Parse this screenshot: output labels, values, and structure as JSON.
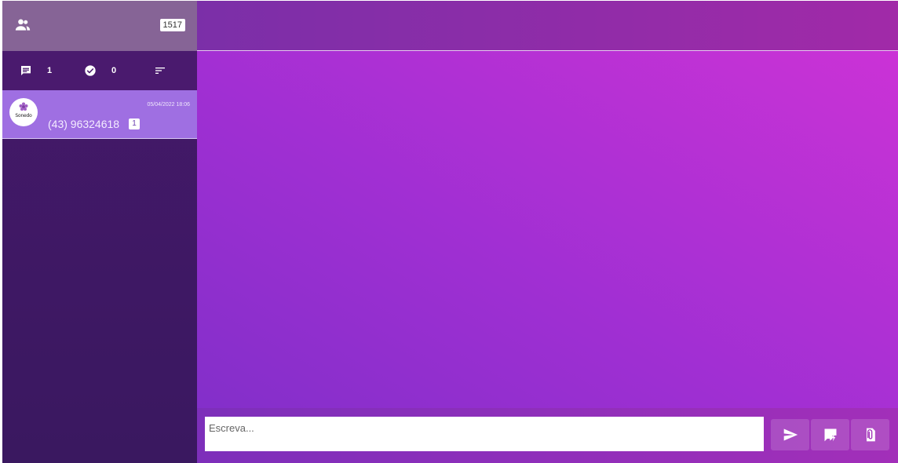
{
  "sidebar": {
    "contacts_count": "1517",
    "filters": [
      {
        "icon": "chat-icon",
        "count": "1"
      },
      {
        "icon": "check-circle-icon",
        "count": "0"
      },
      {
        "icon": "sort-icon"
      }
    ],
    "chats": [
      {
        "avatar_label": "Sonedo",
        "time": "05/04/2022 18:06",
        "phone": "(43) 96324618",
        "unread": "1"
      }
    ]
  },
  "composer": {
    "placeholder": "Escreva...",
    "buttons": [
      "send-icon",
      "quick-reply-icon",
      "attachment-icon"
    ]
  },
  "colors": {
    "sidebar_bg": "#45196a",
    "header_bg": "#866496",
    "active_chat_bg": "#9f6fe2",
    "main_gradient_start": "#7e2fc8",
    "main_gradient_end": "#d033d6"
  }
}
